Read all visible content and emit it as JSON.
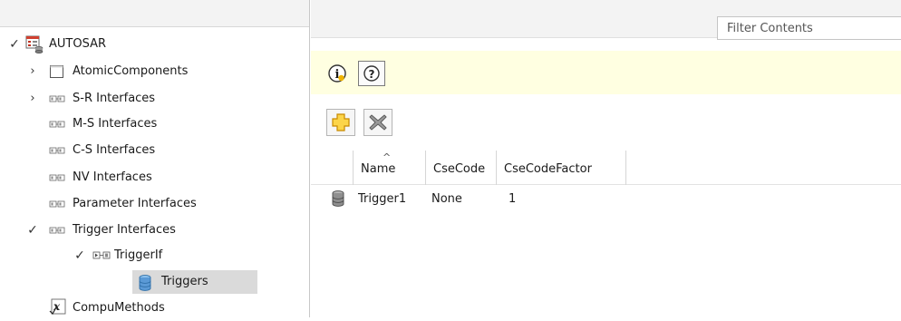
{
  "tree": {
    "items": [
      {
        "label": "AUTOSAR",
        "expander": "down",
        "icon": "autosar-package-icon"
      },
      {
        "label": "AtomicComponents",
        "expander": "right",
        "icon": "component-icon"
      },
      {
        "label": "S-R Interfaces",
        "expander": "right",
        "icon": "interface-icon"
      },
      {
        "label": "M-S Interfaces",
        "expander": "",
        "icon": "interface-icon"
      },
      {
        "label": "C-S Interfaces",
        "expander": "",
        "icon": "interface-icon"
      },
      {
        "label": "NV Interfaces",
        "expander": "",
        "icon": "interface-icon"
      },
      {
        "label": "Parameter Interfaces",
        "expander": "",
        "icon": "interface-icon"
      },
      {
        "label": "Trigger Interfaces",
        "expander": "down",
        "icon": "interface-icon"
      },
      {
        "label": "TriggerIf",
        "expander": "down",
        "icon": "trigger-interface-icon"
      },
      {
        "label": "Triggers",
        "expander": "",
        "icon": "database-icon",
        "selected": true
      },
      {
        "label": "CompuMethods",
        "expander": "",
        "icon": "compu-method-icon"
      }
    ]
  },
  "filter": {
    "placeholder": "Filter Contents",
    "value": ""
  },
  "toolbar": {
    "info_icon": "info-icon",
    "help_icon": "help-icon",
    "add_icon": "add-icon",
    "delete_icon": "delete-icon"
  },
  "table": {
    "columns": [
      "Name",
      "CseCode",
      "CseCodeFactor"
    ],
    "sorted_column": "Name",
    "rows": [
      {
        "name": "Trigger1",
        "csecode": "None",
        "csecodefactor": "1",
        "icon": "database-icon"
      }
    ]
  },
  "colors": {
    "info_bar": "#ffffe1",
    "header_bg": "#f3f3f3",
    "selection": "#dadada",
    "add_icon": "#f0b400",
    "delete_icon": "#8c8c8c"
  }
}
